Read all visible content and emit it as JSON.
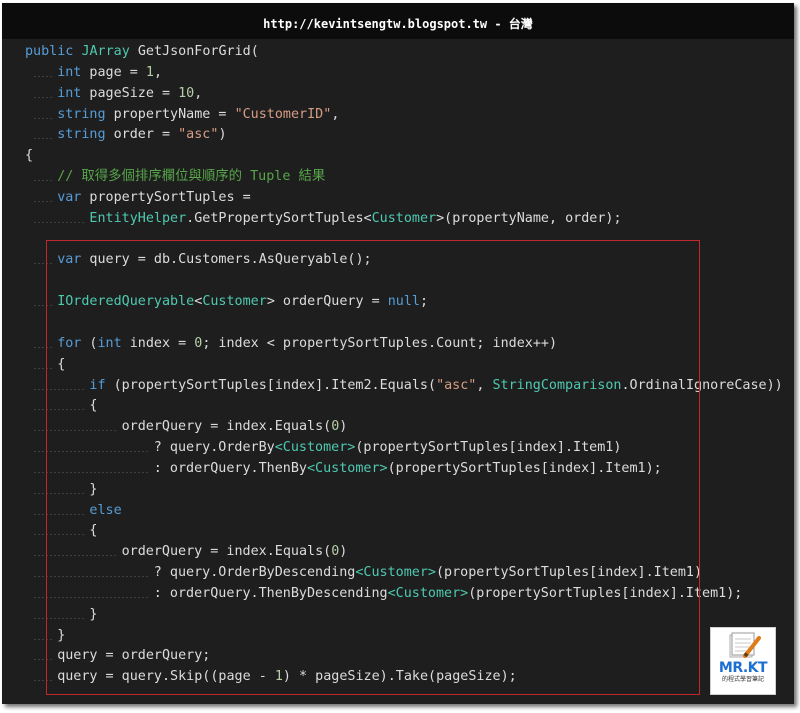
{
  "header": {
    "title": "http://kevintsengtw.blogspot.tw - 台灣"
  },
  "code_lines": [
    {
      "indent": 0,
      "tokens": [
        [
          "kw",
          "public"
        ],
        [
          "p",
          " "
        ],
        [
          "ty",
          "JArray"
        ],
        [
          "p",
          " GetJsonForGrid("
        ]
      ]
    },
    {
      "indent": 1,
      "tokens": [
        [
          "kw",
          "int"
        ],
        [
          "p",
          " page = "
        ],
        [
          "num",
          "1"
        ],
        [
          "p",
          ","
        ]
      ]
    },
    {
      "indent": 1,
      "tokens": [
        [
          "kw",
          "int"
        ],
        [
          "p",
          " pageSize = "
        ],
        [
          "num",
          "10"
        ],
        [
          "p",
          ","
        ]
      ]
    },
    {
      "indent": 1,
      "tokens": [
        [
          "kw",
          "string"
        ],
        [
          "p",
          " propertyName = "
        ],
        [
          "str",
          "\"CustomerID\""
        ],
        [
          "p",
          ","
        ]
      ]
    },
    {
      "indent": 1,
      "tokens": [
        [
          "kw",
          "string"
        ],
        [
          "p",
          " order = "
        ],
        [
          "str",
          "\"asc\""
        ],
        [
          "p",
          ")"
        ]
      ]
    },
    {
      "indent": 0,
      "tokens": [
        [
          "p",
          "{"
        ]
      ]
    },
    {
      "indent": 1,
      "tokens": [
        [
          "cm",
          "// 取得多個排序欄位與順序的 Tuple 結果"
        ]
      ]
    },
    {
      "indent": 1,
      "tokens": [
        [
          "kw",
          "var"
        ],
        [
          "p",
          " propertySortTuples ="
        ]
      ]
    },
    {
      "indent": 2,
      "tokens": [
        [
          "ty",
          "EntityHelper"
        ],
        [
          "p",
          ".GetPropertySortTuples<"
        ],
        [
          "ty",
          "Customer"
        ],
        [
          "p",
          ">(propertyName, order);"
        ]
      ]
    },
    {
      "indent": 0,
      "tokens": []
    },
    {
      "indent": 1,
      "tokens": [
        [
          "kw",
          "var"
        ],
        [
          "p",
          " query = db.Customers.AsQueryable();"
        ]
      ]
    },
    {
      "indent": 0,
      "tokens": []
    },
    {
      "indent": 1,
      "tokens": [
        [
          "ty",
          "IOrderedQueryable"
        ],
        [
          "p",
          "<"
        ],
        [
          "ty",
          "Customer"
        ],
        [
          "p",
          "> orderQuery = "
        ],
        [
          "kw",
          "null"
        ],
        [
          "p",
          ";"
        ]
      ]
    },
    {
      "indent": 0,
      "tokens": []
    },
    {
      "indent": 1,
      "tokens": [
        [
          "kw",
          "for"
        ],
        [
          "p",
          " ("
        ],
        [
          "kw",
          "int"
        ],
        [
          "p",
          " index = "
        ],
        [
          "num",
          "0"
        ],
        [
          "p",
          "; index < propertySortTuples.Count; index++)"
        ]
      ]
    },
    {
      "indent": 1,
      "tokens": [
        [
          "p",
          "{"
        ]
      ]
    },
    {
      "indent": 2,
      "tokens": [
        [
          "kw",
          "if"
        ],
        [
          "p",
          " (propertySortTuples[index].Item2.Equals("
        ],
        [
          "str",
          "\"asc\""
        ],
        [
          "p",
          ", "
        ],
        [
          "ty",
          "StringComparison"
        ],
        [
          "p",
          ".OrdinalIgnoreCase))"
        ]
      ]
    },
    {
      "indent": 2,
      "tokens": [
        [
          "p",
          "{"
        ]
      ]
    },
    {
      "indent": 3,
      "tokens": [
        [
          "p",
          "orderQuery = index.Equals("
        ],
        [
          "num",
          "0"
        ],
        [
          "p",
          ")"
        ]
      ]
    },
    {
      "indent": 4,
      "tokens": [
        [
          "p",
          "? query.OrderBy"
        ],
        [
          "gen",
          "<Customer>"
        ],
        [
          "p",
          "(propertySortTuples[index].Item1)"
        ]
      ]
    },
    {
      "indent": 4,
      "tokens": [
        [
          "p",
          ": orderQuery.ThenBy"
        ],
        [
          "gen",
          "<Customer>"
        ],
        [
          "p",
          "(propertySortTuples[index].Item1);"
        ]
      ]
    },
    {
      "indent": 2,
      "tokens": [
        [
          "p",
          "}"
        ]
      ]
    },
    {
      "indent": 2,
      "tokens": [
        [
          "kw",
          "else"
        ]
      ]
    },
    {
      "indent": 2,
      "tokens": [
        [
          "p",
          "{"
        ]
      ]
    },
    {
      "indent": 3,
      "tokens": [
        [
          "p",
          "orderQuery = index.Equals("
        ],
        [
          "num",
          "0"
        ],
        [
          "p",
          ")"
        ]
      ]
    },
    {
      "indent": 4,
      "tokens": [
        [
          "p",
          "? query.OrderByDescending"
        ],
        [
          "gen",
          "<Customer>"
        ],
        [
          "p",
          "(propertySortTuples[index].Item1)"
        ]
      ]
    },
    {
      "indent": 4,
      "tokens": [
        [
          "p",
          ": orderQuery.ThenByDescending"
        ],
        [
          "gen",
          "<Customer>"
        ],
        [
          "p",
          "(propertySortTuples[index].Item1);"
        ]
      ]
    },
    {
      "indent": 2,
      "tokens": [
        [
          "p",
          "}"
        ]
      ]
    },
    {
      "indent": 1,
      "tokens": [
        [
          "p",
          "}"
        ]
      ]
    },
    {
      "indent": 1,
      "tokens": [
        [
          "p",
          "query = orderQuery;"
        ]
      ]
    },
    {
      "indent": 1,
      "tokens": [
        [
          "p",
          "query = query.Skip((page - "
        ],
        [
          "num",
          "1"
        ],
        [
          "p",
          ") * pageSize).Take(pageSize);"
        ]
      ]
    }
  ],
  "logo": {
    "name": "MR.KT",
    "subtitle": "的程式學習筆記"
  },
  "colors": {
    "background": "#1e1e1e",
    "title_bar": "#0c0c0c",
    "keyword": "#569cd6",
    "type": "#4ec9b0",
    "string": "#d69d85",
    "number": "#b5cea8",
    "highlight_border": "#c1282c"
  },
  "icons": {
    "logo": "notebook-pen-logo-icon"
  }
}
